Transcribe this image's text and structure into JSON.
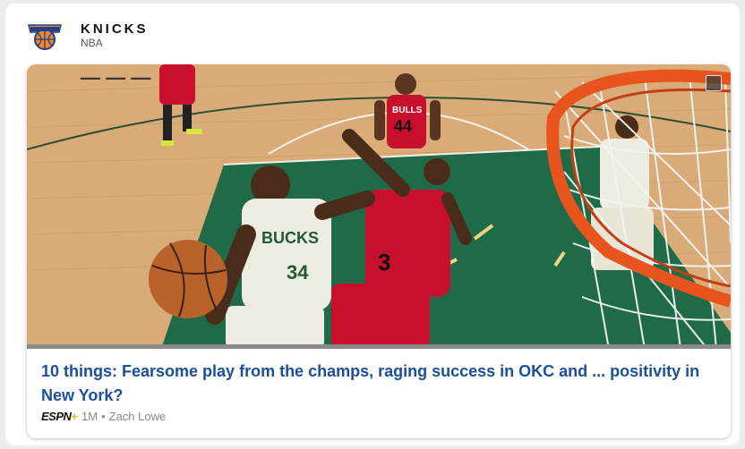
{
  "header": {
    "team_name": "KNICKS",
    "league": "NBA",
    "logo_icon": "knicks-logo"
  },
  "article": {
    "headline": "10 things: Fearsome play from the champs, raging success in OKC and ... positivity in New York?",
    "source": "ESPN",
    "source_plus": "+",
    "age": "1M",
    "separator": "•",
    "author": "Zach Lowe",
    "image_alt": "Giannis Antetokounmpo drives to the basket against the Chicago Bulls",
    "jersey_home": "34",
    "jersey_away_1": "44",
    "jersey_away_2": "3",
    "team_home_word": "BUCKS",
    "team_away_word": "BULLS"
  },
  "colors": {
    "headline": "#1a4f9c",
    "court_wood": "#d9ab79",
    "court_paint": "#1f6b47",
    "bulls_red": "#c8102e",
    "rim_orange": "#e8541e"
  }
}
